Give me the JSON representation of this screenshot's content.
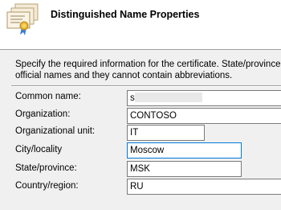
{
  "header": {
    "title": "Distinguished Name Properties",
    "icon": "certificate-icon"
  },
  "instructions": {
    "line1": "Specify the required information for the certificate. State/province and City/l",
    "line2": "official names and they cannot contain abbreviations."
  },
  "fields": [
    {
      "label": "Common name:",
      "value": "s                        c"
    },
    {
      "label": "Organization:",
      "value": "CONTOSO"
    },
    {
      "label": "Organizational unit:",
      "value": "IT"
    },
    {
      "label": "City/locality",
      "value": "Moscow"
    },
    {
      "label": "State/province:",
      "value": "MSK"
    },
    {
      "label": "Country/region:",
      "value": "RU"
    }
  ],
  "colors": {
    "focus_border": "#0078d7",
    "background": "#f0f0f0",
    "header_background": "#ffffff"
  }
}
